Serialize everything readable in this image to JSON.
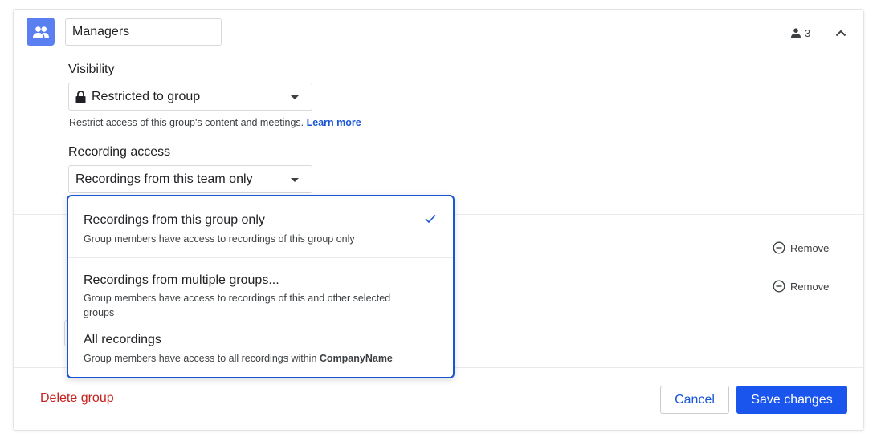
{
  "group": {
    "name": "Managers",
    "member_count": "3"
  },
  "visibility": {
    "label": "Visibility",
    "selected": "Restricted to group",
    "helper": "Restrict access of this group's content and meetings.",
    "learn_more": "Learn more"
  },
  "recording_access": {
    "label": "Recording access",
    "selected": "Recordings from this team only",
    "options": [
      {
        "title": "Recordings from this group only",
        "description": "Group members have access to recordings of this group only",
        "checked": true
      },
      {
        "title": "Recordings from multiple groups...",
        "description": "Group members have access to recordings of this and other selected groups",
        "checked": false
      },
      {
        "title": "All recordings",
        "description_prefix": "Group members have access to all recordings within",
        "description_bold": "CompanyName",
        "checked": false
      }
    ]
  },
  "members": {
    "remove_label": "Remove"
  },
  "footer": {
    "delete_label": "Delete group",
    "cancel_label": "Cancel",
    "save_label": "Save changes"
  },
  "colors": {
    "accent": "#1a55ee",
    "link": "#1a57d6",
    "danger": "#c5221f",
    "avatar_bg": "#5a7ff0"
  },
  "icons": [
    "group-icon",
    "person-icon",
    "chevron-up-icon",
    "lock-icon",
    "caret-down-icon",
    "check-icon",
    "remove-circle-icon"
  ]
}
